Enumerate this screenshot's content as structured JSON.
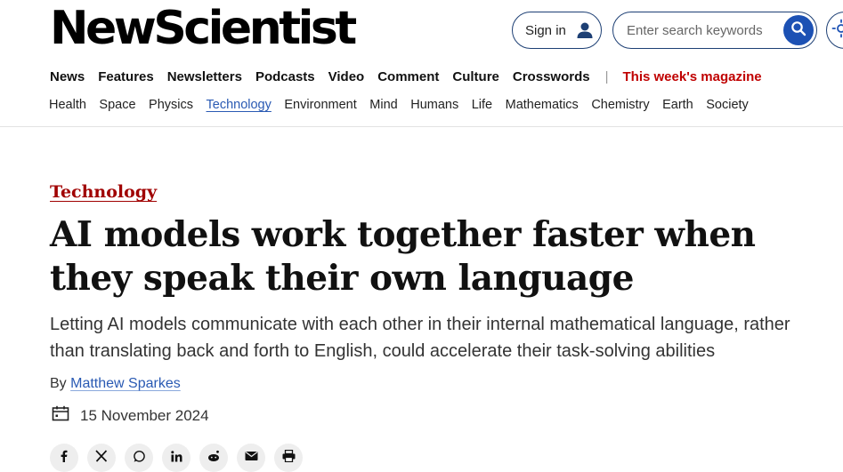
{
  "header": {
    "logo": "NewScientist",
    "sign_in": "Sign in",
    "search_placeholder": "Enter search keywords"
  },
  "main_nav": [
    "News",
    "Features",
    "Newsletters",
    "Podcasts",
    "Video",
    "Comment",
    "Culture",
    "Crosswords"
  ],
  "magazine_link": "This week's magazine",
  "sub_nav": [
    "Health",
    "Space",
    "Physics",
    "Technology",
    "Environment",
    "Mind",
    "Humans",
    "Life",
    "Mathematics",
    "Chemistry",
    "Earth",
    "Society"
  ],
  "article": {
    "section": "Technology",
    "headline": "AI models work together faster when they speak their own language",
    "standfirst": "Letting AI models communicate with each other in their internal mathematical language, rather than translating back and forth to English, could accelerate their task-solving abilities",
    "byline_prefix": "By",
    "author": "Matthew Sparkes",
    "date": "15 November 2024"
  },
  "share_icons": [
    "facebook-icon",
    "x-icon",
    "whatsapp-icon",
    "linkedin-icon",
    "reddit-icon",
    "email-icon",
    "print-icon"
  ],
  "colors": {
    "brand_red": "#c00000",
    "link_blue": "#2a5ab3",
    "search_button": "#1c51b4",
    "outline_navy": "#1d3f74"
  }
}
